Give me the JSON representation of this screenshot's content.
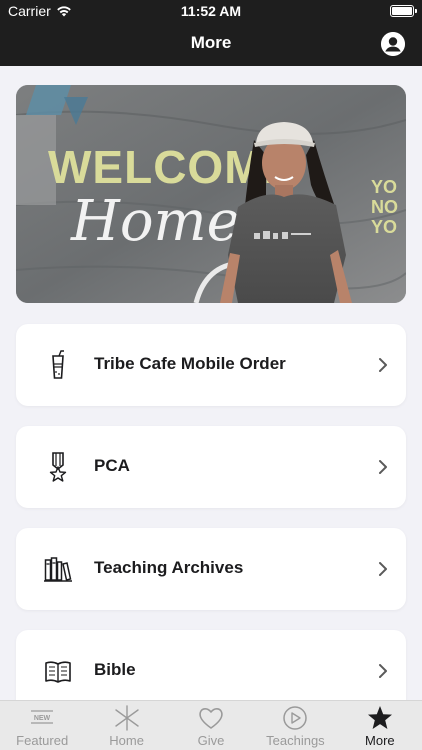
{
  "status_bar": {
    "carrier": "Carrier",
    "time": "11:52 AM"
  },
  "nav": {
    "title": "More"
  },
  "hero": {
    "sign_text": "WELCOME",
    "script_text": "Home",
    "right_text_top": "YO",
    "right_text_mid": "NO",
    "right_text_bot": "YO"
  },
  "menu": {
    "items": [
      {
        "label": "Tribe Cafe Mobile Order",
        "icon": "cup-icon"
      },
      {
        "label": "PCA",
        "icon": "medal-icon"
      },
      {
        "label": "Teaching Archives",
        "icon": "books-icon"
      },
      {
        "label": "Bible",
        "icon": "book-icon"
      }
    ]
  },
  "tabs": {
    "items": [
      {
        "label": "Featured",
        "icon": "newspaper-icon",
        "badge": "NEW"
      },
      {
        "label": "Home",
        "icon": "asterisk-icon"
      },
      {
        "label": "Give",
        "icon": "heart-icon"
      },
      {
        "label": "Teachings",
        "icon": "play-icon"
      },
      {
        "label": "More",
        "icon": "star-icon"
      }
    ],
    "active": "More"
  },
  "colors": {
    "nav_bg": "#1e1e1e",
    "page_bg": "#f2f2f7",
    "card_bg": "#ffffff",
    "tab_bg": "#e9e9e9",
    "tab_inactive": "#9a9a9a"
  }
}
